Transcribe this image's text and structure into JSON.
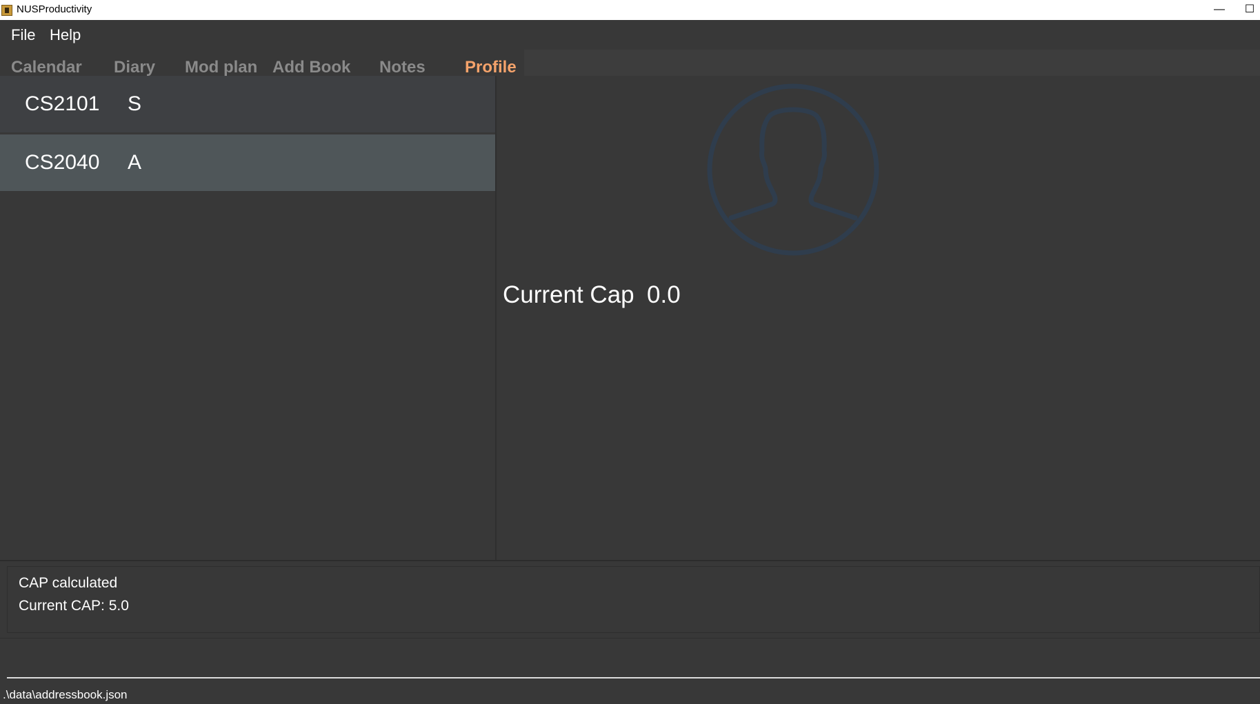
{
  "window": {
    "title": "NUSProductivity",
    "minimize_glyph": "—",
    "maximize_glyph": "☐"
  },
  "menu": {
    "items": [
      {
        "label": "File"
      },
      {
        "label": "Help"
      }
    ]
  },
  "tabs": [
    {
      "label": "Calendar",
      "active": false
    },
    {
      "label": "Diary",
      "active": false
    },
    {
      "label": "Mod plan",
      "active": false
    },
    {
      "label": "Add Book",
      "active": false
    },
    {
      "label": "Notes",
      "active": false
    },
    {
      "label": "Profile",
      "active": true
    }
  ],
  "modules": [
    {
      "code": "CS2101",
      "grade": "S",
      "selected": false
    },
    {
      "code": "CS2040",
      "grade": "A",
      "selected": true
    }
  ],
  "profile": {
    "avatar_icon": "user-silhouette-icon",
    "cap_label": "Current Cap",
    "cap_value": "0.0"
  },
  "result": {
    "lines": [
      "CAP calculated",
      "Current CAP: 5.0"
    ]
  },
  "command": {
    "value": "",
    "placeholder": ""
  },
  "status": {
    "path": ".\\data\\addressbook.json"
  },
  "colors": {
    "background": "#383838",
    "active_tab": "#f5a36b",
    "inactive_tab": "#8a8a8a",
    "selected_row": "#4f5659",
    "avatar_stroke": "#2f3d4d"
  }
}
